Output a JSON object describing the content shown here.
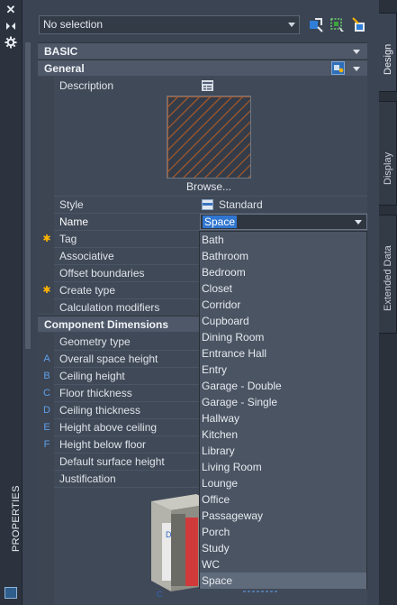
{
  "selection": {
    "value": "No selection"
  },
  "tabs": [
    "Design",
    "Display",
    "Extended Data"
  ],
  "palette_title": "PROPERTIES",
  "sections": {
    "basic": "BASIC",
    "general": "General",
    "component": "Component Dimensions"
  },
  "general": {
    "description_label": "Description",
    "browse_label": "Browse...",
    "style_label": "Style",
    "style_value": "Standard",
    "name_label": "Name",
    "name_value": "Space",
    "tag_label": "Tag",
    "associative_label": "Associative",
    "offset_label": "Offset boundaries",
    "create_type_label": "Create type",
    "calc_label": "Calculation modifiers"
  },
  "dimensions": [
    {
      "mark": "",
      "label": "Geometry type"
    },
    {
      "mark": "A",
      "label": "Overall space height"
    },
    {
      "mark": "B",
      "label": "Ceiling height"
    },
    {
      "mark": "C",
      "label": "Floor thickness"
    },
    {
      "mark": "D",
      "label": "Ceiling thickness"
    },
    {
      "mark": "E",
      "label": "Height above ceiling"
    },
    {
      "mark": "F",
      "label": "Height below floor"
    },
    {
      "mark": "",
      "label": "Default surface height"
    },
    {
      "mark": "",
      "label": "Justification"
    }
  ],
  "name_options": [
    "Bath",
    "Bathroom",
    "Bedroom",
    "Closet",
    "Corridor",
    "Cupboard",
    "Dining Room",
    "Entrance Hall",
    "Entry",
    "Garage - Double",
    "Garage - Single",
    "Hallway",
    "Kitchen",
    "Library",
    "Living Room",
    "Lounge",
    "Office",
    "Passageway",
    "Porch",
    "Study",
    "WC",
    "Space"
  ],
  "highlighted_option": "Space",
  "colors": {
    "accent": "#3076d0",
    "panel": "#404957",
    "marker": "#ffb400",
    "dimension_letter": "#5ea0e8"
  }
}
